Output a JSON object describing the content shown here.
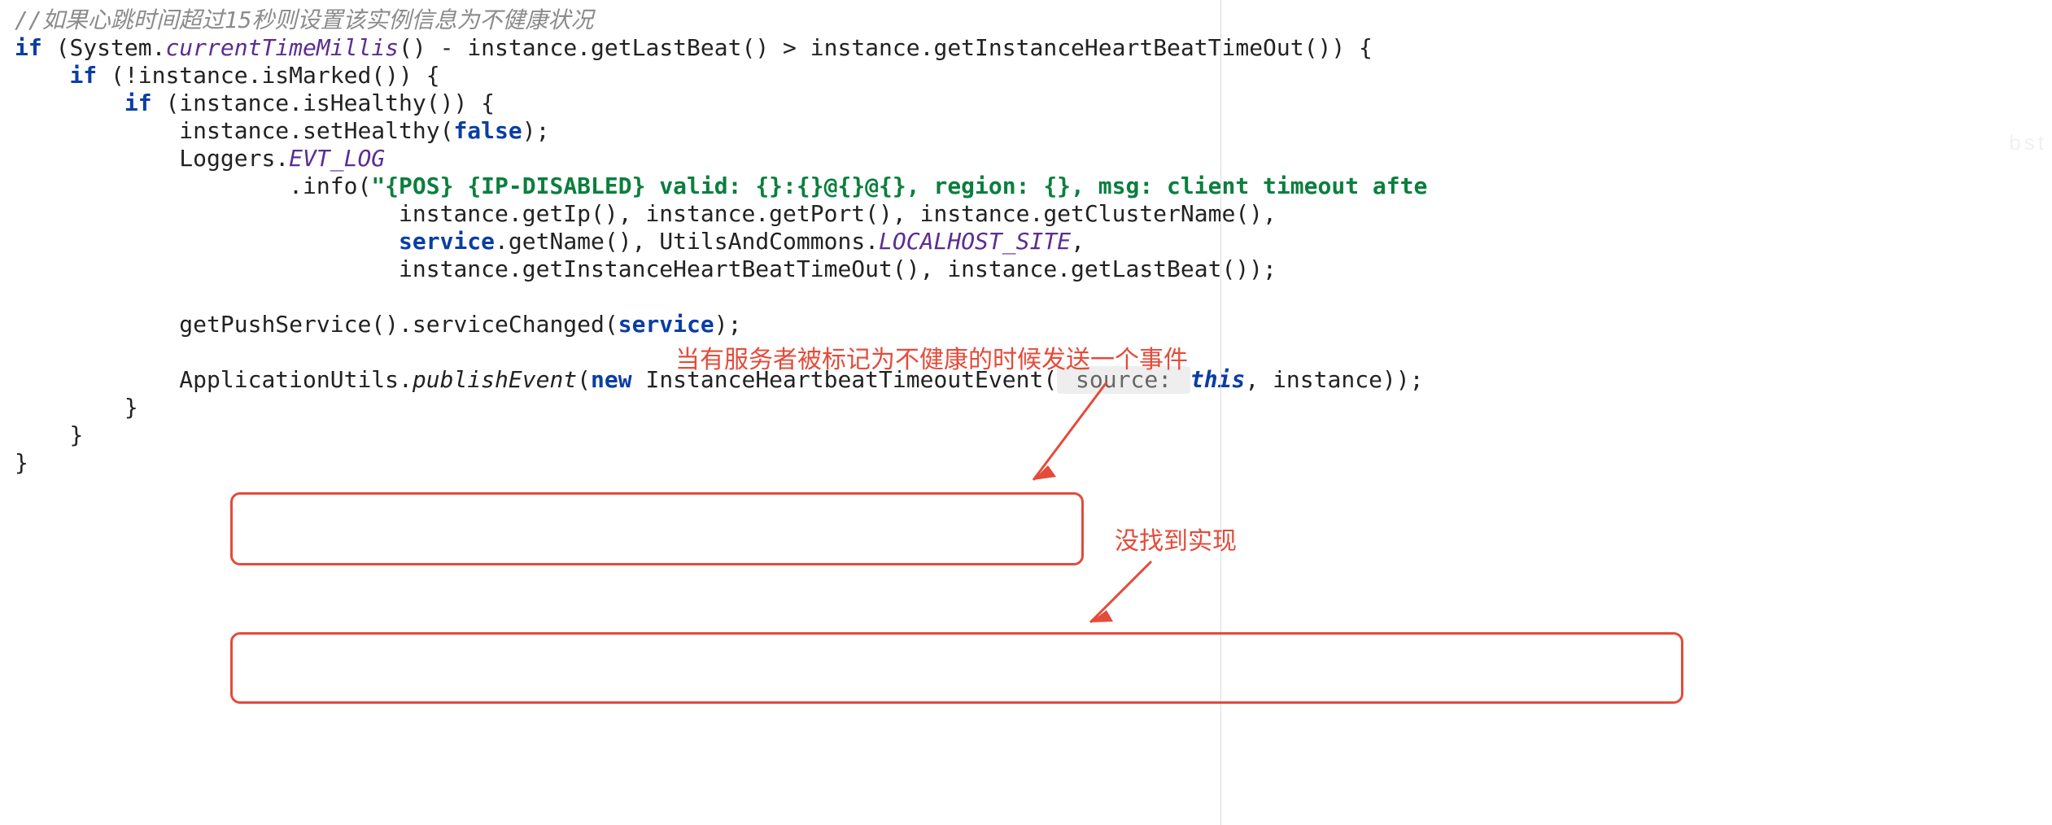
{
  "code": {
    "comment_line": "//如果心跳时间超过15秒则设置该实例信息为不健康状况",
    "outer_if_prefix": "if",
    "outer_if_cond_system": "System",
    "outer_if_cond_ctm": "currentTimeMillis",
    "outer_if_cond_rest_a": "() - instance.getLastBeat() > instance.getInstanceHeartBeatTimeOut()) {",
    "if_marked_prefix": "if",
    "if_marked_cond": "(!instance.isMarked()) {",
    "if_healthy_prefix": "if",
    "if_healthy_cond": "(instance.isHealthy()) {",
    "set_healthy_call": "instance.setHealthy(",
    "false_kw": "false",
    "set_healthy_end": ");",
    "loggers_prefix": "Loggers.",
    "evt_log": "EVT_LOG",
    "info_call": ".info(",
    "log_string": "\"{POS} {IP-DISABLED} valid: {}:{}@{}@{}, region: {}, msg: client timeout afte",
    "log_args_1": "instance.getIp(), instance.getPort(), instance.getClusterName(),",
    "log_args_2a": "service",
    "log_args_2b": ".getName(), UtilsAndCommons.",
    "localhost_site": "LOCALHOST_SITE",
    "log_args_2c": ",",
    "log_args_3": "instance.getInstanceHeartBeatTimeOut(), instance.getLastBeat());",
    "push_line": "getPushService().serviceChanged(",
    "push_arg": "service",
    "push_end": ");",
    "app_utils": "ApplicationUtils.",
    "publish_event": "publishEvent",
    "pub_open": "(",
    "new_kw": "new",
    "event_ctor": " InstanceHeartbeatTimeoutEvent(",
    "hint_source": " source: ",
    "this_kw": "this",
    "pub_rest": ", instance));",
    "close1": "}",
    "close2": "}",
    "close3": "}"
  },
  "annotations": {
    "top_note": "当有服务者被标记为不健康的时候发送一个事件",
    "right_note": "没找到实现"
  },
  "colors": {
    "callout": "#e44b3a",
    "keyword": "#0a3ea4",
    "string": "#0b7f3e",
    "static_ref": "#5c2d91",
    "comment": "#8b8b8b"
  }
}
